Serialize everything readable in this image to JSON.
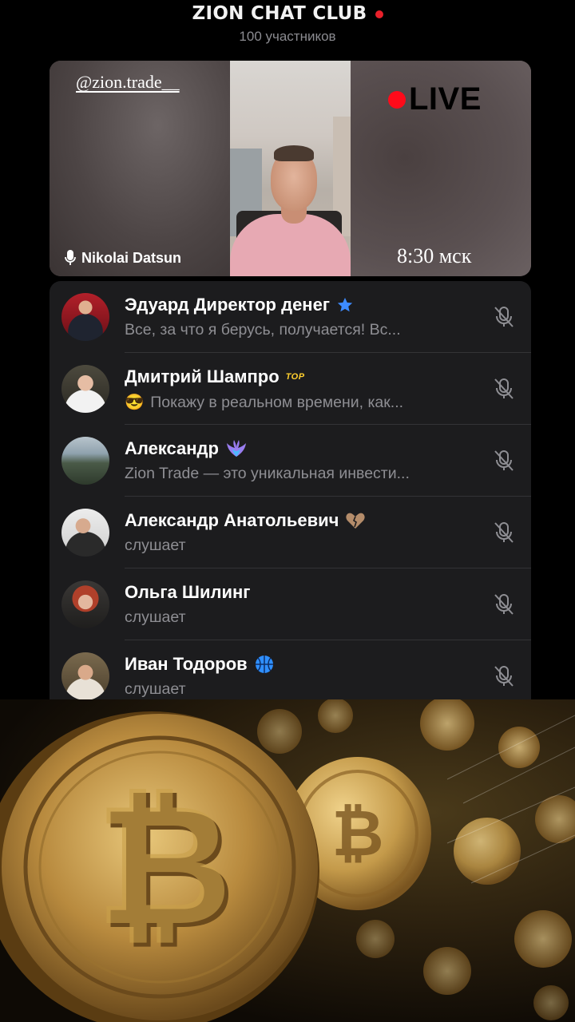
{
  "header": {
    "title": "ZION CHAT CLUB",
    "subtitle": "100 участников"
  },
  "video": {
    "handle": "@zion.trade__",
    "live_label": "LIVE",
    "speaker_name": "Nikolai Datsun",
    "time": "8:30 мск"
  },
  "participants": [
    {
      "name": "Эдуард Директор денег",
      "badge": "star-icon",
      "status": "Все, за что я берусь, получается! Вс...",
      "status_emoji": ""
    },
    {
      "name": "Дмитрий Шампро",
      "badge": "top-badge-icon",
      "badge_text": "TOP",
      "status": "Покажу в реальном времени, как...",
      "status_emoji": "😎"
    },
    {
      "name": "Александр",
      "badge": "phoenix-icon",
      "status": "Zion Trade — это уникальная инвести...",
      "status_emoji": ""
    },
    {
      "name": "Александр Анатольевич",
      "badge": "broken-heart-icon",
      "status": "слушает",
      "status_emoji": ""
    },
    {
      "name": "Ольга Шилинг",
      "badge": "",
      "status": "слушает",
      "status_emoji": ""
    },
    {
      "name": "Иван Тодоров",
      "badge": "basketball-icon",
      "status": "слушает",
      "status_emoji": ""
    }
  ],
  "colors": {
    "live_red": "#ff0b1a",
    "list_bg": "#1c1c1e",
    "muted_text": "#8e8e93",
    "gold": "#c9a04a"
  }
}
